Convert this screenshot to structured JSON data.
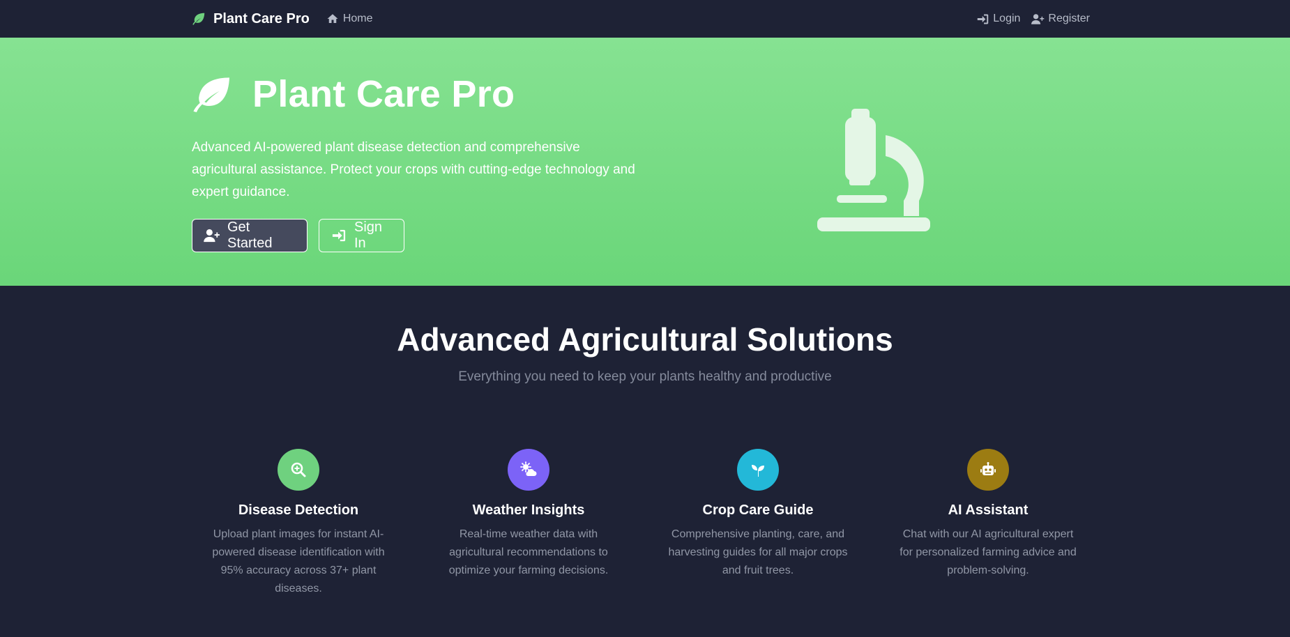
{
  "navbar": {
    "brand": "Plant Care Pro",
    "home": "Home",
    "login": "Login",
    "register": "Register"
  },
  "hero": {
    "title": "Plant Care Pro",
    "description": "Advanced AI-powered plant disease detection and comprehensive agricultural assistance. Protect your crops with cutting-edge technology and expert guidance.",
    "get_started": "Get Started",
    "sign_in": "Sign In"
  },
  "features": {
    "title": "Advanced Agricultural Solutions",
    "subtitle": "Everything you need to keep your plants healthy and productive",
    "cards": [
      {
        "title": "Disease Detection",
        "description": "Upload plant images for instant AI-powered disease identification with 95% accuracy across 37+ plant diseases.",
        "icon": "magnifier-plus-icon",
        "color": "#6fd17f"
      },
      {
        "title": "Weather Insights",
        "description": "Real-time weather data with agricultural recommendations to optimize your farming decisions.",
        "icon": "cloud-sun-icon",
        "color": "#7c63f7"
      },
      {
        "title": "Crop Care Guide",
        "description": "Comprehensive planting, care, and harvesting guides for all major crops and fruit trees.",
        "icon": "seedling-icon",
        "color": "#23b8d8"
      },
      {
        "title": "AI Assistant",
        "description": "Chat with our AI agricultural expert for personalized farming advice and problem-solving.",
        "icon": "robot-icon",
        "color": "#9c7c12"
      }
    ]
  },
  "colors": {
    "background": "#1e2235",
    "hero_green": "#7adc87",
    "brand_leaf": "#6fd17f"
  }
}
